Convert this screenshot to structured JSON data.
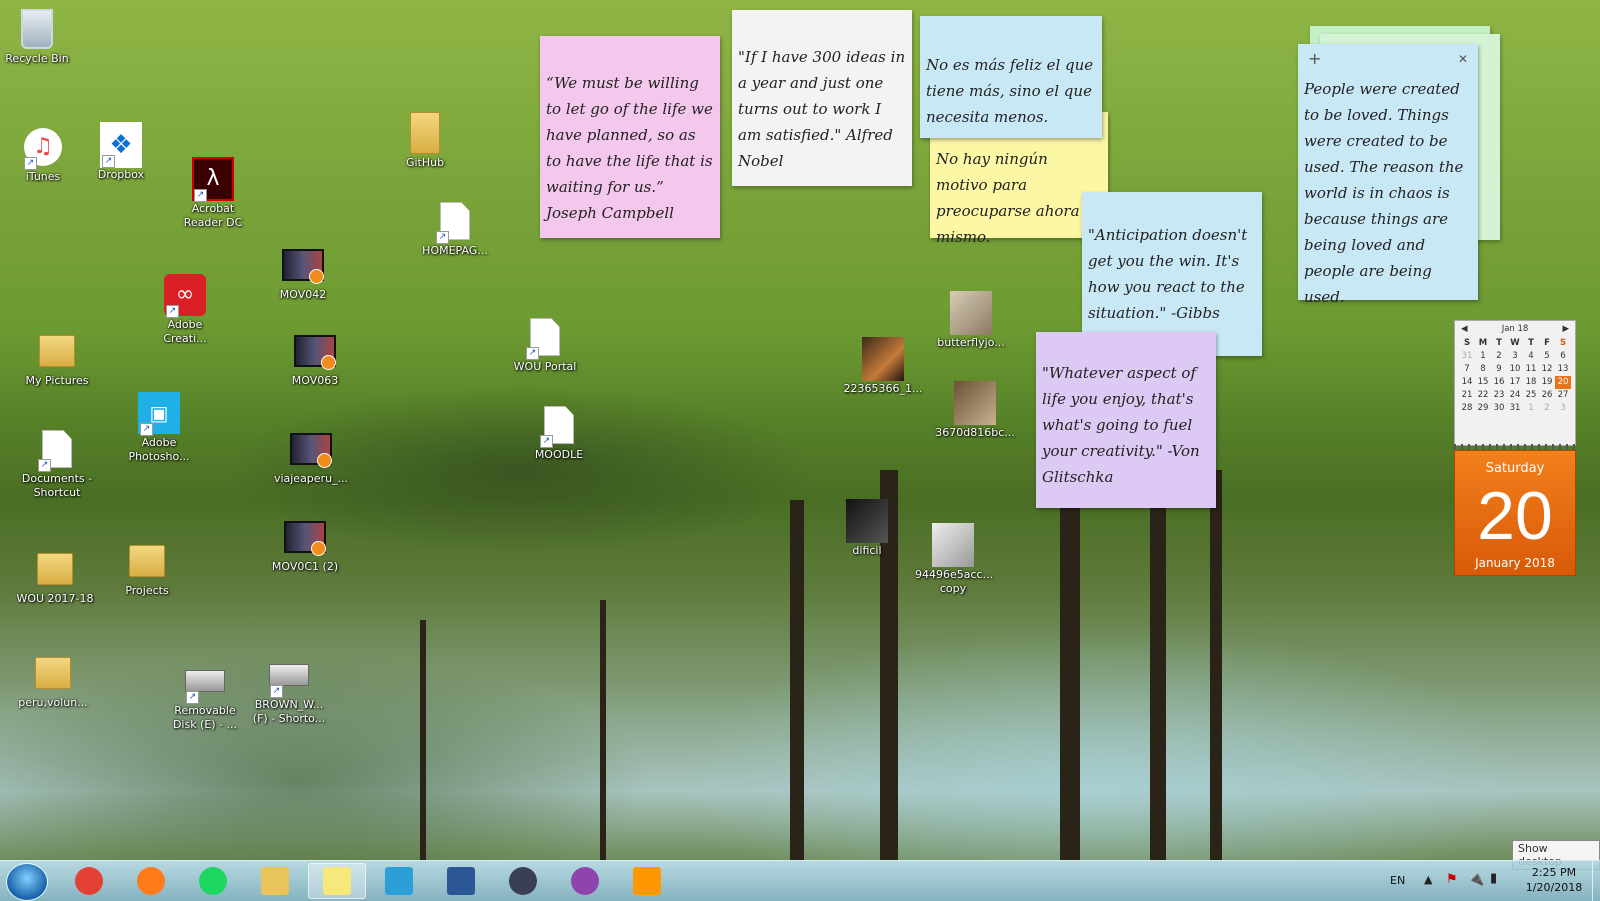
{
  "desktop_icons": [
    {
      "label": "Recycle Bin",
      "icon": "recycle-bin-icon"
    },
    {
      "label": "iTunes",
      "icon": "itunes-icon"
    },
    {
      "label": "Dropbox",
      "icon": "dropbox-icon"
    },
    {
      "label": "Acrobat Reader DC",
      "icon": "acrobat-icon"
    },
    {
      "label": "Adobe Creati...",
      "icon": "creative-cloud-icon"
    },
    {
      "label": "My Pictures",
      "icon": "folder-icon"
    },
    {
      "label": "Adobe Photosho...",
      "icon": "photoshop-icon"
    },
    {
      "label": "Documents - Shortcut",
      "icon": "documents-icon"
    },
    {
      "label": "WOU 2017-18",
      "icon": "folder-icon"
    },
    {
      "label": "Projects",
      "icon": "folder-icon"
    },
    {
      "label": "peru,volun...",
      "icon": "folder-icon"
    },
    {
      "label": "Removable Disk (E) - ...",
      "icon": "drive-icon"
    },
    {
      "label": "BROWN_W... (F) - Shorto...",
      "icon": "drive-icon"
    },
    {
      "label": "MOV042",
      "icon": "video-icon"
    },
    {
      "label": "MOV063",
      "icon": "video-icon"
    },
    {
      "label": "viajeaperu_...",
      "icon": "video-icon"
    },
    {
      "label": "MOV0C1 (2)",
      "icon": "video-icon"
    },
    {
      "label": "GitHub",
      "icon": "folder-icon"
    },
    {
      "label": "HOMEPAG...",
      "icon": "file-icon"
    },
    {
      "label": "WOU Portal",
      "icon": "file-icon"
    },
    {
      "label": "MOODLE",
      "icon": "file-icon"
    },
    {
      "label": "22365366_1...",
      "icon": "image-icon"
    },
    {
      "label": "dificil",
      "icon": "image-icon"
    },
    {
      "label": "butterflyjo...",
      "icon": "image-icon"
    },
    {
      "label": "3670d816bc...",
      "icon": "image-icon"
    },
    {
      "label": "94496e5acc... copy",
      "icon": "image-icon"
    }
  ],
  "notes": [
    {
      "text": "“We must be willing to let go of the life we have planned, so as to have the life that is waiting for us.” Joseph Campbell",
      "color": "#f4c7ec"
    },
    {
      "text": "\"If I have 300 ideas in a year and just one turns out to work I am satisfied.\" Alfred Nobel",
      "color": "#f3f3f3"
    },
    {
      "text": "No es más feliz el que tiene más, sino el que necesita menos.",
      "color": "#c9e8f6"
    },
    {
      "text": "No hay ningún motivo para preocuparse ahora mismo.",
      "color": "#fcf7a5"
    },
    {
      "text": "\"Anticipation doesn't get you the win. It's how you react to the situation.\" -Gibbs",
      "color": "#c9e8f6"
    },
    {
      "text": "\"Whatever aspect of life you enjoy, that's what's going to fuel your creativity.\" -Von Glitschka",
      "color": "#dcc9f4"
    },
    {
      "text": "People were created to be loved. Things were created to be used. The reason the world is in chaos is because things are being loved and people are being used.",
      "color": "#c9e8f6",
      "add_label": "+",
      "close_label": "✕"
    }
  ],
  "calendar": {
    "month_label": "Jan 18",
    "weekdays": [
      "S",
      "M",
      "T",
      "W",
      "T",
      "F",
      "S"
    ],
    "days": [
      "31",
      "1",
      "2",
      "3",
      "4",
      "5",
      "6",
      "7",
      "8",
      "9",
      "10",
      "11",
      "12",
      "13",
      "14",
      "15",
      "16",
      "17",
      "18",
      "19",
      "20",
      "21",
      "22",
      "23",
      "24",
      "25",
      "26",
      "27",
      "28",
      "29",
      "30",
      "31",
      "1",
      "2",
      "3"
    ],
    "today": "20",
    "weekday_full": "Saturday",
    "month_year": "January 2018",
    "prev": "◀",
    "next": "▶"
  },
  "taskbar": {
    "apps": [
      {
        "name": "chrome",
        "icon": "chrome-icon",
        "color": "#e34133"
      },
      {
        "name": "firefox",
        "icon": "firefox-icon",
        "color": "#ff7a1a"
      },
      {
        "name": "spotify",
        "icon": "spotify-icon",
        "color": "#1ed760"
      },
      {
        "name": "explorer",
        "icon": "folder-icon",
        "color": "#e8c45a"
      },
      {
        "name": "sticky-notes",
        "icon": "sticky-notes-icon",
        "color": "#f6e87b"
      },
      {
        "name": "photos",
        "icon": "photo-gallery-icon",
        "color": "#2a9fd8"
      },
      {
        "name": "word",
        "icon": "word-icon",
        "color": "#2b5797"
      },
      {
        "name": "camera",
        "icon": "camera-icon",
        "color": "#3a3f55"
      },
      {
        "name": "github-desktop",
        "icon": "github-icon",
        "color": "#8e44ad"
      },
      {
        "name": "sublime",
        "icon": "sublime-icon",
        "color": "#ff9800"
      }
    ],
    "language": "EN",
    "time": "2:25 PM",
    "date": "1/20/2018",
    "show_desktop": "Show desktop"
  }
}
